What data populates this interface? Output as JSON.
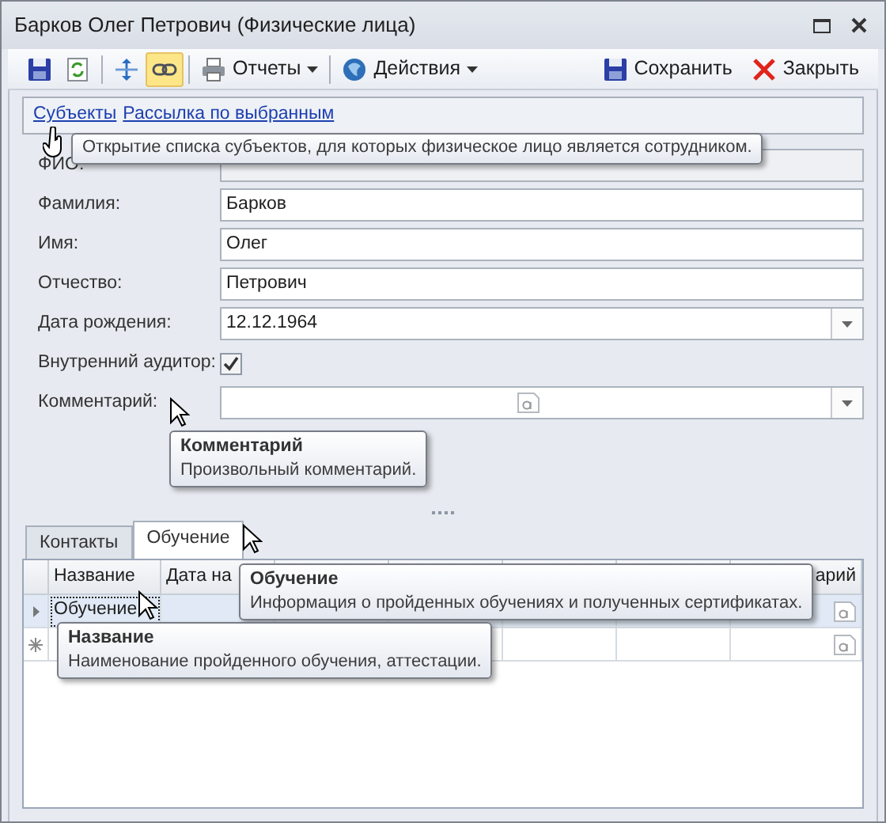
{
  "window": {
    "title": "Барков Олег Петрович (Физические лица)"
  },
  "toolbar": {
    "left": [
      {
        "kind": "icon",
        "selected": false
      },
      {
        "kind": "icon",
        "selected": false
      },
      {
        "kind": "separator"
      },
      {
        "kind": "icon",
        "selected": false
      },
      {
        "kind": "icon",
        "selected": true
      },
      {
        "kind": "separator"
      },
      {
        "kind": "menu",
        "label": "Отчеты"
      },
      {
        "kind": "separator"
      },
      {
        "kind": "menu",
        "label": "Действия"
      }
    ],
    "right": [
      {
        "label": "Сохранить"
      },
      {
        "label": "Закрыть"
      }
    ]
  },
  "links": [
    {
      "label": "Субъекты"
    },
    {
      "label": "Рассылка по выбранным"
    }
  ],
  "link_tooltip": {
    "text": "Открытие списка субъектов, для которых физическое лицо является сотрудником."
  },
  "form": {
    "fields": [
      {
        "label": "ФИО:",
        "kind": "readonly"
      },
      {
        "label": "Фамилия:",
        "kind": "text",
        "value": "Барков"
      },
      {
        "label": "Имя:",
        "kind": "text",
        "value": "Олег"
      },
      {
        "label": "Отчество:",
        "kind": "text",
        "value": "Петрович"
      },
      {
        "label": "Дата рождения:",
        "kind": "date",
        "value": "12.12.1964"
      },
      {
        "label": "Внутренний аудитор:",
        "kind": "checkbox",
        "checked": true
      },
      {
        "label": "Комментарий:",
        "kind": "memo"
      }
    ]
  },
  "comment_tooltip": {
    "title": "Комментарий",
    "text": "Произвольный комментарий."
  },
  "tabs": [
    {
      "label": "Контакты",
      "selected": false
    },
    {
      "label": "Обучение",
      "selected": true
    }
  ],
  "grid": {
    "columns": [
      {
        "kind": "text",
        "label": "Название"
      },
      {
        "kind": "text",
        "label": "Дата на"
      },
      {
        "kind": "blank"
      },
      {
        "kind": "blank"
      },
      {
        "kind": "blank"
      },
      {
        "kind": "blank"
      },
      {
        "kind": "text",
        "label": "арий"
      }
    ],
    "rows": [
      {
        "kind": "data",
        "selected": true,
        "cells": [
          {
            "text": "Обучение",
            "focused": true
          }
        ]
      },
      {
        "kind": "new",
        "selected": false
      }
    ]
  },
  "tab_tooltip": {
    "title": "Обучение",
    "text": "Информация о пройденных обучениях и полученных сертификатах."
  },
  "column_tooltip": {
    "title": "Название",
    "text": "Наименование пройденного обучения, аттестации."
  }
}
